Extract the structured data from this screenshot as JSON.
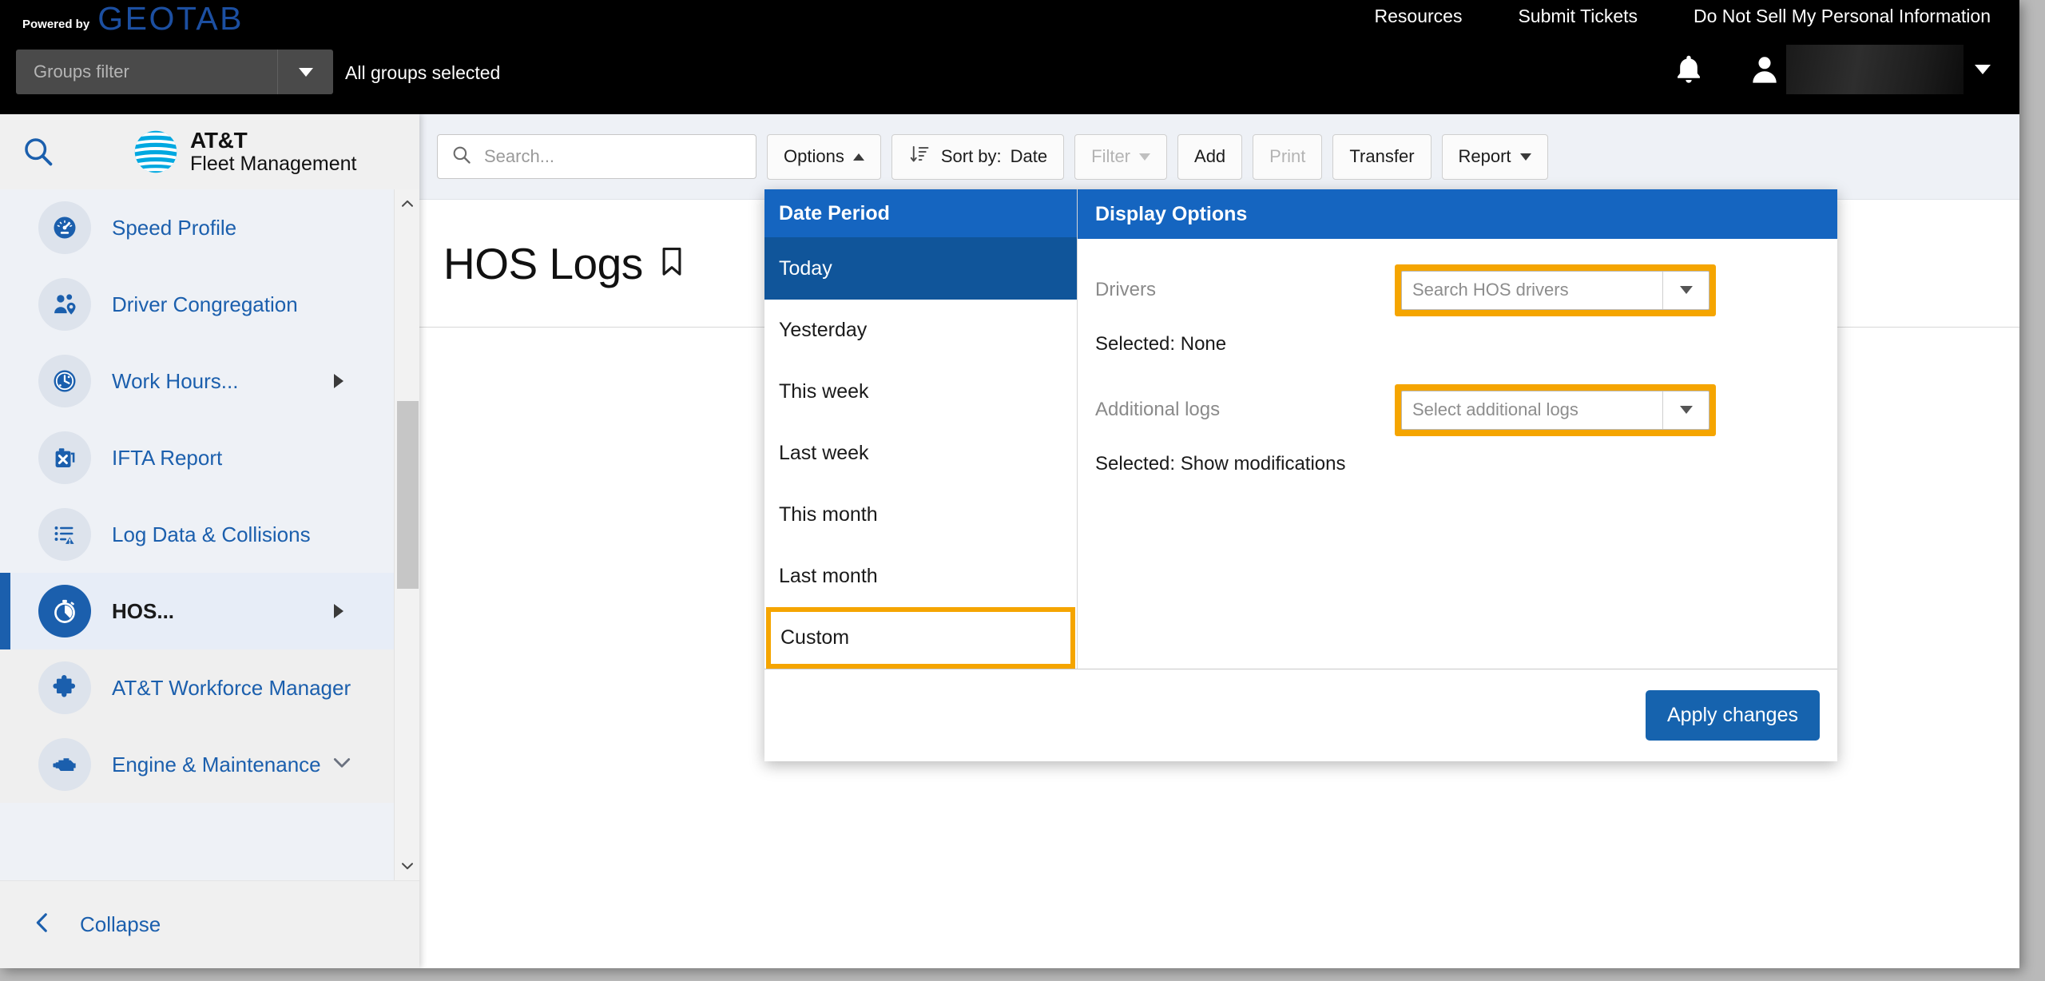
{
  "topbar": {
    "powered_by": "Powered by",
    "brand": "GEOTAB",
    "groups_filter_placeholder": "Groups filter",
    "groups_status": "All groups selected",
    "links": [
      {
        "label": "Resources"
      },
      {
        "label": "Submit Tickets"
      },
      {
        "label": "Do Not Sell My Personal Information"
      }
    ],
    "username": ""
  },
  "sidebar": {
    "brand_line1": "AT&T",
    "brand_line2": "Fleet Management",
    "collapse_label": "Collapse",
    "items": [
      {
        "label": "Speed Profile",
        "icon": "speedometer-icon",
        "state": "plain",
        "chevron": "none"
      },
      {
        "label": "Driver Congregation",
        "icon": "people-pin-icon",
        "state": "plain",
        "chevron": "none"
      },
      {
        "label": "Work Hours...",
        "icon": "clock-icon",
        "state": "plain",
        "chevron": "right"
      },
      {
        "label": "IFTA Report",
        "icon": "fuel-can-icon",
        "state": "plain",
        "chevron": "none"
      },
      {
        "label": "Log Data & Collisions",
        "icon": "log-list-icon",
        "state": "plain",
        "chevron": "none"
      },
      {
        "label": "HOS...",
        "icon": "stopwatch-icon",
        "state": "active",
        "chevron": "right"
      },
      {
        "label": "AT&T Workforce Manager",
        "icon": "puzzle-icon",
        "state": "grey",
        "chevron": "none"
      },
      {
        "label": "Engine & Maintenance",
        "icon": "engine-icon",
        "state": "grey",
        "chevron": "down"
      }
    ]
  },
  "toolbar": {
    "search_placeholder": "Search...",
    "options_label": "Options",
    "sort_label": "Sort by:",
    "sort_value": "Date",
    "filter_label": "Filter",
    "add_label": "Add",
    "print_label": "Print",
    "transfer_label": "Transfer",
    "report_label": "Report"
  },
  "page": {
    "title": "HOS Logs"
  },
  "options_panel": {
    "date_period": {
      "header": "Date Period",
      "items": [
        {
          "label": "Today",
          "selected": true,
          "highlighted": false
        },
        {
          "label": "Yesterday",
          "selected": false,
          "highlighted": false
        },
        {
          "label": "This week",
          "selected": false,
          "highlighted": false
        },
        {
          "label": "Last week",
          "selected": false,
          "highlighted": false
        },
        {
          "label": "This month",
          "selected": false,
          "highlighted": false
        },
        {
          "label": "Last month",
          "selected": false,
          "highlighted": false
        },
        {
          "label": "Custom",
          "selected": false,
          "highlighted": true
        }
      ]
    },
    "display_options": {
      "header": "Display Options",
      "drivers_label": "Drivers",
      "drivers_placeholder": "Search HOS drivers",
      "drivers_selected": "Selected: None",
      "additional_logs_label": "Additional logs",
      "additional_logs_placeholder": "Select additional logs",
      "additional_logs_selected": "Selected: Show modifications"
    },
    "apply_label": "Apply changes"
  },
  "colors": {
    "brand_blue": "#1b5fad",
    "panel_header_blue": "#1565C0",
    "selected_row_blue": "#10559A",
    "highlight_orange": "#f5a500",
    "apply_button_blue": "#1663ae",
    "geotab_blue": "#1c4fa1",
    "att_cyan": "#00a8e0"
  }
}
